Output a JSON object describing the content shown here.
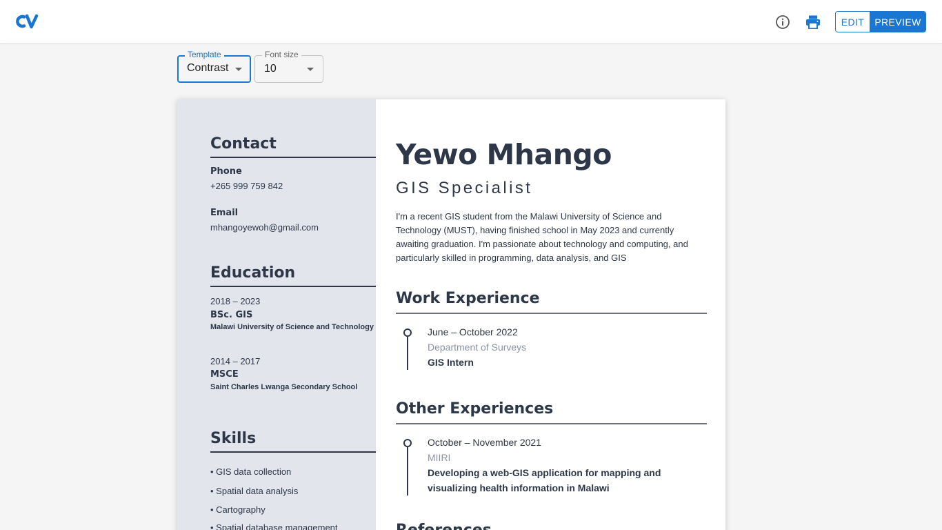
{
  "app": {
    "logo_text": "CV",
    "brand_color": "#1976d2",
    "icons": {
      "info": "info-icon",
      "print": "print-icon"
    },
    "mode": {
      "edit_label": "EDIT",
      "preview_label": "PREVIEW",
      "active": "PREVIEW"
    }
  },
  "controls": {
    "template": {
      "label": "Template",
      "value": "Contrast"
    },
    "font_size": {
      "label": "Font size",
      "value": "10"
    }
  },
  "cv": {
    "name": "Yewo Mhango",
    "role": "GIS Specialist",
    "summary": "I'm a recent GIS student from the Malawi University of Science and Technology (MUST), having finished school in May 2023 and currently awaiting graduation. I'm passionate about technology and computing, and particularly skilled in programming, data analysis, and GIS",
    "sidebar": {
      "contact": {
        "heading": "Contact",
        "phone_label": "Phone",
        "phone": "+265 999 759 842",
        "email_label": "Email",
        "email": "mhangoyewoh@gmail.com"
      },
      "education": {
        "heading": "Education",
        "items": [
          {
            "years": "2018 – 2023",
            "degree": "BSc. GIS",
            "school": "Malawi University of Science and Technology"
          },
          {
            "years": "2014 – 2017",
            "degree": "MSCE",
            "school": "Saint Charles Lwanga Secondary School"
          }
        ]
      },
      "skills": {
        "heading": "Skills",
        "items": [
          "GIS data collection",
          "Spatial data analysis",
          "Cartography",
          "Spatial database management"
        ]
      }
    },
    "work": {
      "heading": "Work Experience",
      "items": [
        {
          "date": "June – October 2022",
          "org": "Department of Surveys",
          "title": "GIS Intern"
        }
      ]
    },
    "other": {
      "heading": "Other Experiences",
      "items": [
        {
          "date": "October – November 2021",
          "org": "MIIRI",
          "title": "Developing a web-GIS application for mapping and visualizing health information in Malawi"
        }
      ]
    },
    "next_heading": "References"
  }
}
